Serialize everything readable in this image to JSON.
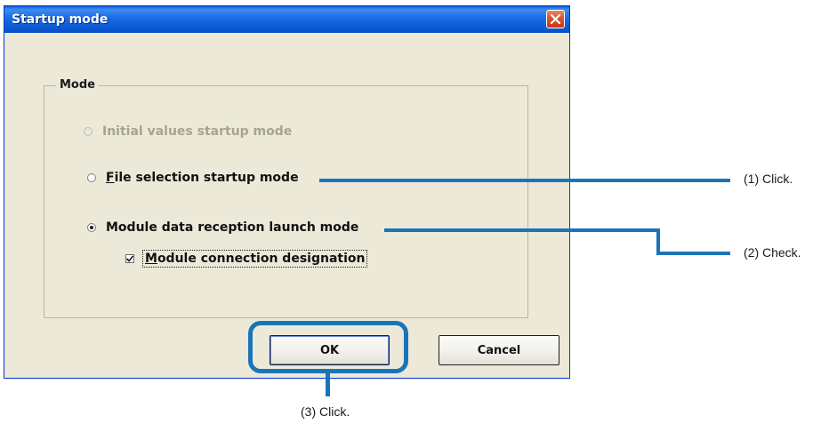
{
  "dialog": {
    "title": "Startup mode",
    "close_icon": "close-icon"
  },
  "mode_group": {
    "label": "Mode",
    "options": [
      {
        "label": "Initial values startup mode",
        "accel": "",
        "rest": "",
        "state": "disabled",
        "selected": false
      },
      {
        "label": "",
        "accel": "F",
        "rest": "ile selection startup mode",
        "state": "enabled",
        "selected": false
      },
      {
        "label": "Module data reception launch mode",
        "accel": "",
        "rest": "",
        "state": "enabled",
        "selected": true
      }
    ],
    "checkbox": {
      "accel": "M",
      "rest": "odule connection designation",
      "checked": true
    }
  },
  "buttons": {
    "ok": "OK",
    "cancel": "Cancel"
  },
  "annotations": {
    "step1": "(1) Click.",
    "step2": "(2) Check.",
    "step3": "(3) Click."
  },
  "colors": {
    "title_bar": "#0a5fd8",
    "dialog_bg": "#ece9d8",
    "callout": "#1a75b8",
    "close_button": "#d8532f"
  }
}
